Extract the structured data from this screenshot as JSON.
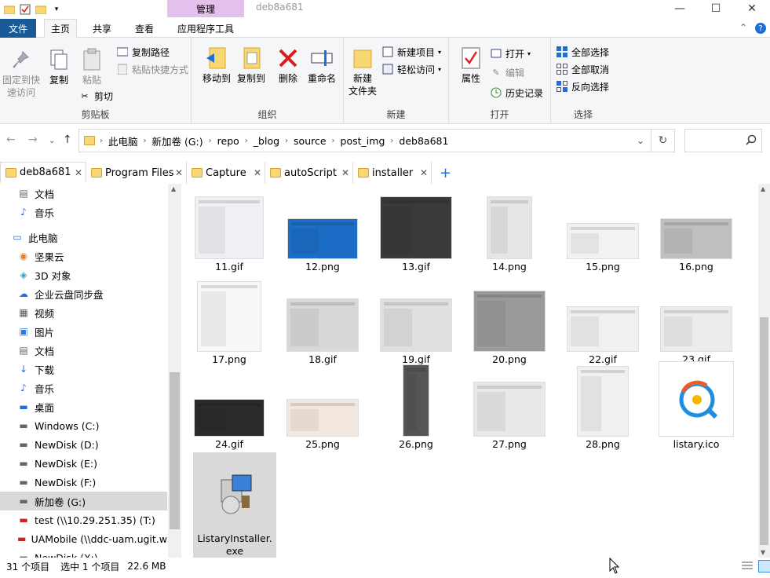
{
  "window": {
    "title": "deb8a681",
    "context_tab": "管理",
    "minimize": "—",
    "maximize": "☐",
    "close": "✕"
  },
  "ribbon_tabs": [
    "文件",
    "主页",
    "共享",
    "查看",
    "应用程序工具"
  ],
  "ribbon": {
    "clipboard": {
      "label": "剪贴板",
      "pin": "固定到快速访问",
      "copy": "复制",
      "paste": "粘贴",
      "copy_path": "复制路径",
      "paste_shortcut": "粘贴快捷方式",
      "cut": "剪切"
    },
    "organize": {
      "label": "组织",
      "move_to": "移动到",
      "copy_to": "复制到",
      "delete": "删除",
      "rename": "重命名"
    },
    "new": {
      "label": "新建",
      "new_folder": "新建\n文件夹",
      "new_item": "新建项目",
      "easy_access": "轻松访问"
    },
    "open": {
      "label": "打开",
      "properties": "属性",
      "open": "打开",
      "edit": "编辑",
      "history": "历史记录"
    },
    "select": {
      "label": "选择",
      "select_all": "全部选择",
      "select_none": "全部取消",
      "invert": "反向选择"
    }
  },
  "address": {
    "crumbs": [
      "此电脑",
      "新加卷 (G:)",
      "repo",
      "_blog",
      "source",
      "post_img",
      "deb8a681"
    ]
  },
  "quick_tabs": [
    {
      "label": "deb8a681"
    },
    {
      "label": "Program Files"
    },
    {
      "label": "Capture"
    },
    {
      "label": "autoScript"
    },
    {
      "label": "installer"
    }
  ],
  "nav": [
    {
      "label": "文档",
      "icon": "document-icon"
    },
    {
      "label": "音乐",
      "icon": "music-icon"
    },
    {
      "label": "此电脑",
      "icon": "computer-icon"
    },
    {
      "label": "坚果云",
      "icon": "nutstore-icon"
    },
    {
      "label": "3D 对象",
      "icon": "3d-objects-icon"
    },
    {
      "label": "企业云盘同步盘",
      "icon": "cloud-icon"
    },
    {
      "label": "视频",
      "icon": "video-icon"
    },
    {
      "label": "图片",
      "icon": "pictures-icon"
    },
    {
      "label": "文档",
      "icon": "document-icon"
    },
    {
      "label": "下载",
      "icon": "download-icon"
    },
    {
      "label": "音乐",
      "icon": "music-icon"
    },
    {
      "label": "桌面",
      "icon": "desktop-icon"
    },
    {
      "label": "Windows (C:)",
      "icon": "drive-icon"
    },
    {
      "label": "NewDisk (D:)",
      "icon": "drive-icon"
    },
    {
      "label": "NewDisk (E:)",
      "icon": "drive-icon"
    },
    {
      "label": "NewDisk (F:)",
      "icon": "drive-icon"
    },
    {
      "label": "新加卷 (G:)",
      "icon": "drive-icon"
    },
    {
      "label": "test (\\\\10.29.251.35) (T:)",
      "icon": "network-drive-icon"
    },
    {
      "label": "UAMobile (\\\\ddc-uam.ugit.w",
      "icon": "network-drive-icon"
    },
    {
      "label": "NewDisk (X:)",
      "icon": "drive-icon"
    }
  ],
  "files": [
    {
      "name": "11.gif"
    },
    {
      "name": "12.png"
    },
    {
      "name": "13.gif"
    },
    {
      "name": "14.png"
    },
    {
      "name": "15.png"
    },
    {
      "name": "16.png"
    },
    {
      "name": "17.png"
    },
    {
      "name": "18.gif"
    },
    {
      "name": "19.gif"
    },
    {
      "name": "20.png"
    },
    {
      "name": "22.gif"
    },
    {
      "name": "23.gif"
    },
    {
      "name": "24.gif"
    },
    {
      "name": "25.png"
    },
    {
      "name": "26.png"
    },
    {
      "name": "27.png"
    },
    {
      "name": "28.png"
    },
    {
      "name": "listary.ico"
    },
    {
      "name": "ListaryInstaller.\nexe"
    }
  ],
  "status": {
    "count": "31 个项目",
    "selected": "选中 1 个项目",
    "size": "22.6 MB"
  }
}
